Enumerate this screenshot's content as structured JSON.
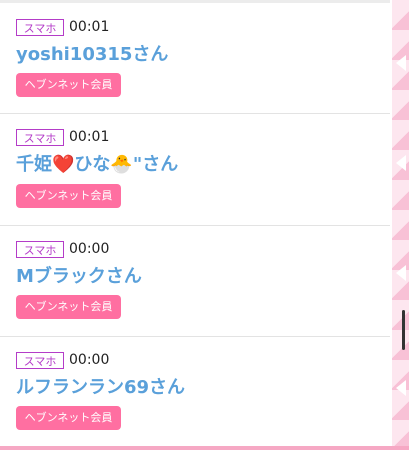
{
  "entries": [
    {
      "device": "スマホ",
      "time": "00:01",
      "name": "yoshi10315さん",
      "member": "ヘブンネット会員"
    },
    {
      "device": "スマホ",
      "time": "00:01",
      "name": "千姫❤️ひな🐣\"さん",
      "member": "ヘブンネット会員"
    },
    {
      "device": "スマホ",
      "time": "00:00",
      "name": "Mブラックさん",
      "member": "ヘブンネット会員"
    },
    {
      "device": "スマホ",
      "time": "00:00",
      "name": "ルフランラン69さん",
      "member": "ヘブンネット会員"
    }
  ],
  "colors": {
    "device_badge": "#b43cc8",
    "name": "#5aa0da",
    "member_badge": "#ff6fa1",
    "accent_pink": "#f6a8c4"
  }
}
